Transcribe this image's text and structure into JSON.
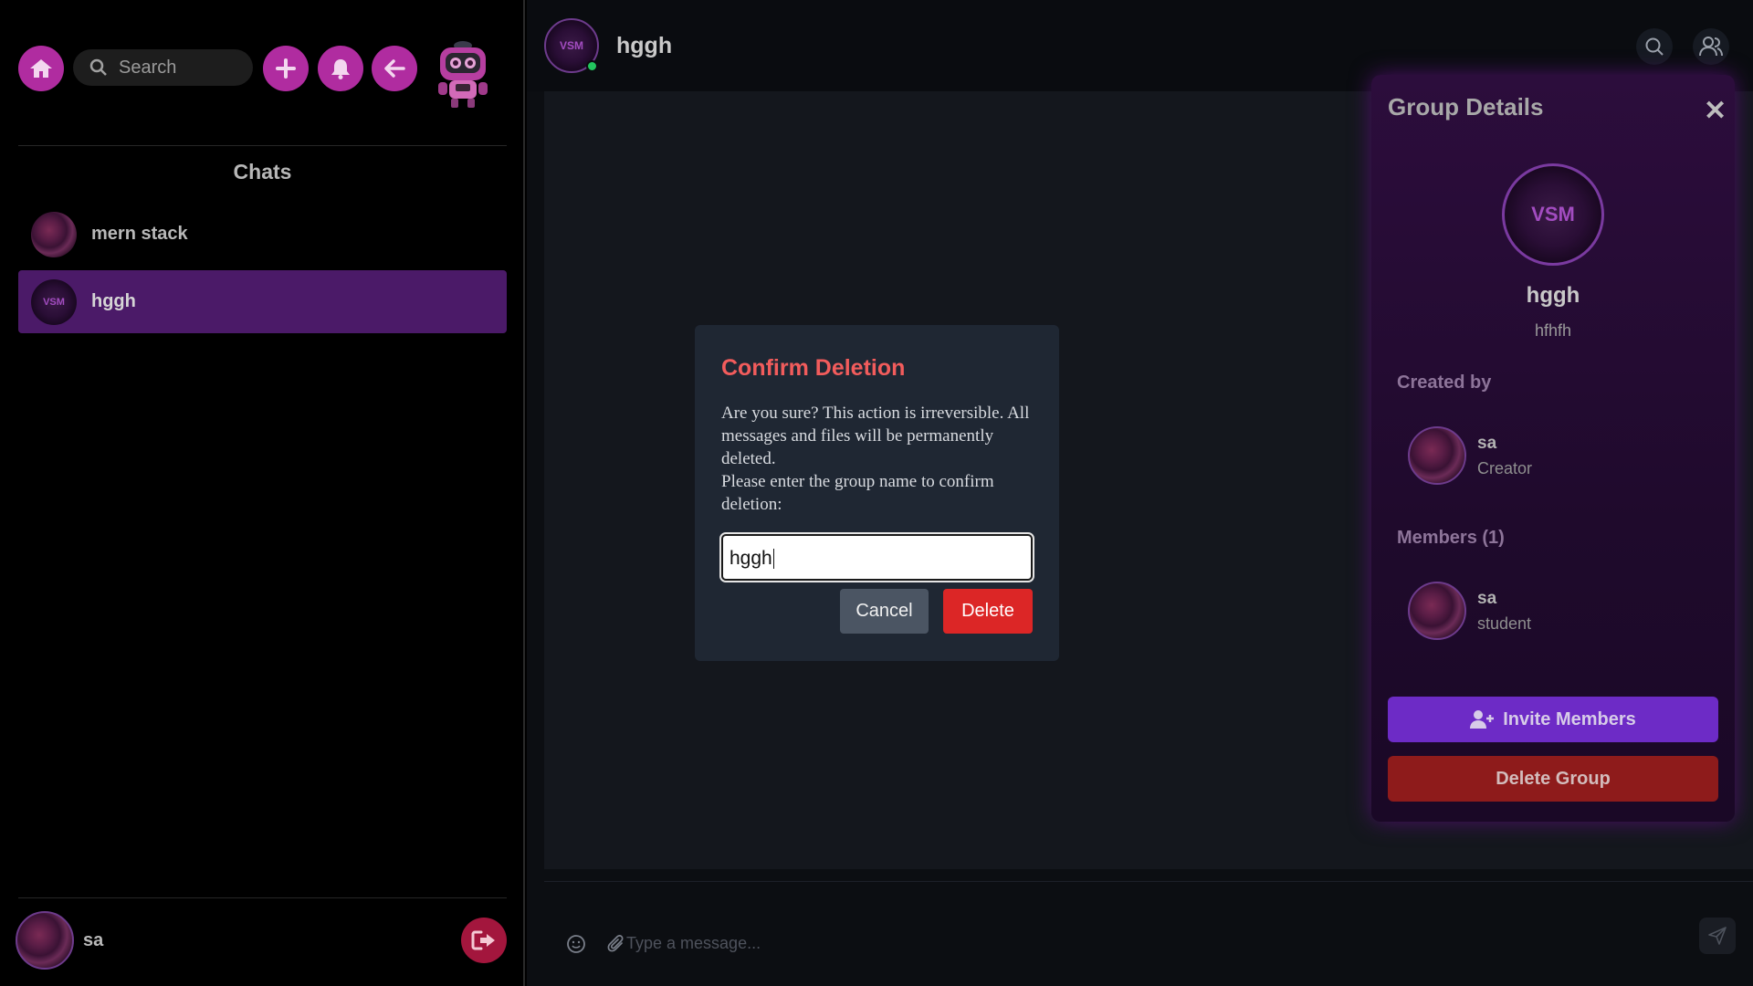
{
  "sidebar": {
    "search_placeholder": "Search",
    "chats_title": "Chats",
    "chats": [
      {
        "name": "mern stack",
        "avatar": "rose-avatar",
        "active": false
      },
      {
        "name": "hggh",
        "avatar": "vsm-avatar",
        "active": true
      }
    ],
    "user": {
      "name": "sa"
    }
  },
  "header": {
    "title": "hggh",
    "avatar_text": "VSM",
    "online": true
  },
  "composer": {
    "placeholder": "Type a message..."
  },
  "group_details": {
    "title": "Group Details",
    "avatar_text": "VSM",
    "name": "hggh",
    "description": "hfhfh",
    "created_by_label": "Created by",
    "creator": {
      "name": "sa",
      "role": "Creator"
    },
    "members_label": "Members (1)",
    "members": [
      {
        "name": "sa",
        "role": "student"
      }
    ],
    "invite_label": "Invite Members",
    "delete_label": "Delete Group"
  },
  "modal": {
    "title": "Confirm Deletion",
    "body_line1": "Are you sure? This action is irreversible. All messages and files will be permanently deleted.",
    "body_line2": "Please enter the group name to confirm deletion:",
    "input_value": "hggh",
    "cancel_label": "Cancel",
    "delete_label": "Delete"
  },
  "colors": {
    "accent": "#b02ca0",
    "active_chat": "#4b1a68",
    "danger": "#dc2626",
    "invite": "#6d2bc6"
  }
}
